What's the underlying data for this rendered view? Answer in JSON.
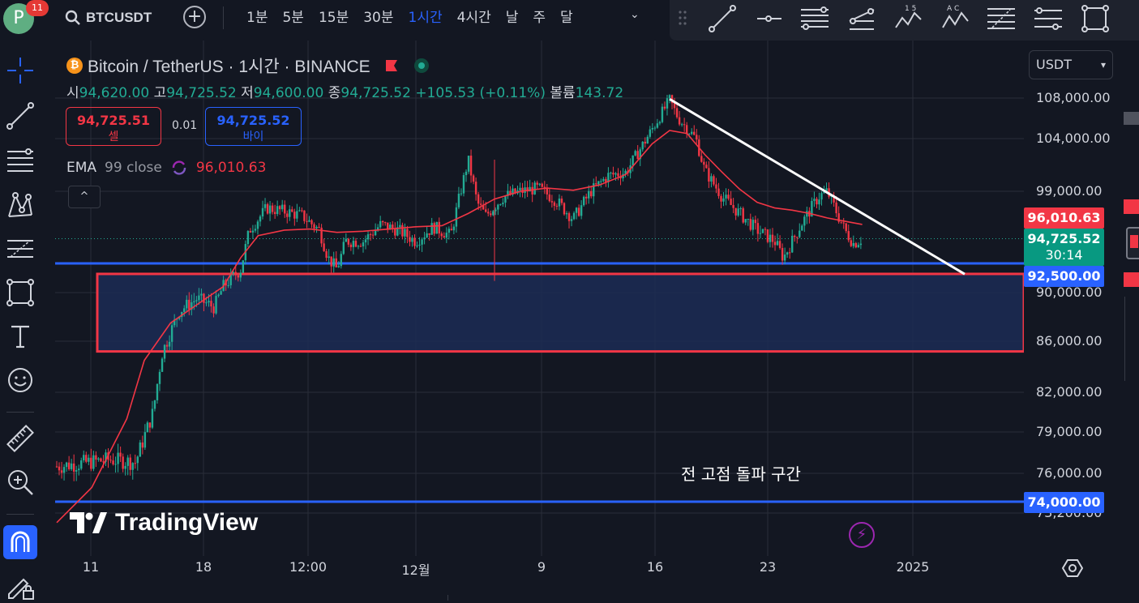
{
  "header": {
    "avatar_letter": "P",
    "notification_count": "11",
    "symbol": "BTCUSDT",
    "add_symbol": "+",
    "intervals": [
      "1분",
      "5분",
      "15분",
      "30분",
      "1시간",
      "4시간",
      "날",
      "주",
      "달"
    ],
    "active_interval": "1시간",
    "interval_chevron": "⌄"
  },
  "drawing_tools": [
    "trend-line-icon",
    "horizontal-ray-icon",
    "parallel-channel-icon",
    "pitchfork-icon",
    "elliott-wave-icon",
    "xabcd-pattern-icon",
    "fib-retracement-icon",
    "prediction-icon",
    "rectangle-icon"
  ],
  "drawing_tool_labels": {
    "elliott": "1 5",
    "pattern": "A C"
  },
  "left_tools": [
    "crosshair-icon",
    "trend-line-icon",
    "fib-icon",
    "pattern-icon",
    "prediction-icon",
    "rectangle-icon",
    "text-icon",
    "emoji-icon",
    "ruler-icon",
    "zoom-in-icon",
    "magnet-icon",
    "pencil-lock-icon"
  ],
  "legend": {
    "coin_glyph": "₿",
    "title": "Bitcoin / TetherUS · 1시간 · BINANCE",
    "ohlc": {
      "open_label": "시",
      "open": "94,620.00",
      "high_label": "고",
      "high": "94,725.52",
      "low_label": "저",
      "low": "94,600.00",
      "close_label": "종",
      "close": "94,725.52",
      "change": "+105.53 (+0.11%)",
      "volume_label": "볼륨",
      "volume": "143.72"
    },
    "sell": {
      "price": "94,725.51",
      "label": "셀"
    },
    "spread": "0.01",
    "buy": {
      "price": "94,725.52",
      "label": "바이"
    },
    "ema": {
      "name": "EMA",
      "params": "99 close",
      "value": "96,010.63"
    },
    "collapse": "^"
  },
  "annotation_text": "전 고점 돌파 구간",
  "watermark": "TradingView",
  "price_scale": {
    "currency": "USDT",
    "ticks": [
      "108,000.00",
      "104,000.00",
      "99,000.00",
      "90,000.00",
      "86,000.00",
      "82,000.00",
      "79,000.00",
      "76,000.00",
      "73,200.00"
    ],
    "labels": {
      "ema": "96,010.63",
      "last": "94,725.52",
      "countdown": "30:14",
      "support": "92,500.00",
      "lower_support": "74,000.00"
    }
  },
  "time_scale": {
    "ticks": [
      "11",
      "18",
      "12:00",
      "12월",
      "9",
      "16",
      "23",
      "2025"
    ]
  },
  "colors": {
    "background": "#131722",
    "up": "#22ab94",
    "down": "#f23645",
    "ema": "#f23645",
    "horizontal_lines": "#2962ff",
    "zone_border": "#f23645",
    "zone_fill": "#1c2b55",
    "trendline": "#ffffff",
    "active": "#2962ff"
  },
  "chart_data": {
    "type": "candlestick",
    "symbol": "Bitcoin / TetherUS",
    "exchange": "BINANCE",
    "interval": "1시간",
    "y_range": [
      71000,
      110000
    ],
    "x_ticks": [
      "11",
      "18",
      "12:00",
      "12월",
      "9",
      "16",
      "23",
      "2025"
    ],
    "price_path": [
      [
        0,
        76500
      ],
      [
        6,
        77000
      ],
      [
        9,
        76800
      ],
      [
        11,
        80500
      ],
      [
        12,
        85000
      ],
      [
        14,
        88500
      ],
      [
        16,
        89500
      ],
      [
        18,
        88800
      ],
      [
        19,
        90500
      ],
      [
        21,
        92000
      ],
      [
        22,
        95500
      ],
      [
        24,
        97500
      ],
      [
        26,
        97200
      ],
      [
        28,
        96800
      ],
      [
        30,
        95500
      ],
      [
        31,
        93000
      ],
      [
        32,
        92000
      ],
      [
        33,
        94500
      ],
      [
        35,
        94500
      ],
      [
        37,
        96000
      ],
      [
        39,
        95500
      ],
      [
        41,
        94500
      ],
      [
        43,
        95800
      ],
      [
        45,
        95000
      ],
      [
        47,
        102000
      ],
      [
        48,
        98000
      ],
      [
        49,
        96800
      ],
      [
        51,
        98500
      ],
      [
        53,
        99000
      ],
      [
        55,
        99300
      ],
      [
        57,
        98200
      ],
      [
        59,
        96500
      ],
      [
        61,
        99000
      ],
      [
        63,
        100500
      ],
      [
        65,
        100800
      ],
      [
        67,
        103500
      ],
      [
        70,
        107800
      ],
      [
        71,
        106000
      ],
      [
        73,
        104000
      ],
      [
        74,
        101000
      ],
      [
        76,
        98500
      ],
      [
        78,
        97000
      ],
      [
        80,
        95500
      ],
      [
        82,
        94500
      ],
      [
        83,
        93000
      ],
      [
        85,
        96000
      ],
      [
        87,
        98500
      ],
      [
        88,
        99000
      ],
      [
        90,
        95500
      ],
      [
        91,
        94300
      ],
      [
        92,
        94725
      ]
    ],
    "ema": {
      "name": "EMA 99 close",
      "value": 96010.63,
      "path": [
        [
          0,
          71500
        ],
        [
          4,
          75000
        ],
        [
          8,
          80000
        ],
        [
          10,
          84500
        ],
        [
          13,
          87500
        ],
        [
          16,
          89000
        ],
        [
          19,
          90500
        ],
        [
          21,
          93000
        ],
        [
          23,
          95000
        ],
        [
          26,
          95500
        ],
        [
          29,
          95600
        ],
        [
          32,
          95300
        ],
        [
          35,
          95400
        ],
        [
          38,
          95600
        ],
        [
          41,
          95800
        ],
        [
          44,
          95900
        ],
        [
          47,
          97000
        ],
        [
          50,
          98300
        ],
        [
          53,
          99000
        ],
        [
          56,
          99300
        ],
        [
          59,
          99100
        ],
        [
          62,
          99600
        ],
        [
          65,
          100600
        ],
        [
          68,
          103500
        ],
        [
          70,
          104800
        ],
        [
          72,
          104500
        ],
        [
          74,
          102500
        ],
        [
          76,
          100800
        ],
        [
          78,
          99200
        ],
        [
          80,
          98000
        ],
        [
          82,
          97500
        ],
        [
          84,
          97300
        ],
        [
          86,
          97000
        ],
        [
          88,
          96600
        ],
        [
          90,
          96300
        ],
        [
          92,
          96010
        ]
      ]
    },
    "last_price": 94725.52,
    "horizontal_lines": [
      92500,
      74000
    ],
    "zone": {
      "from_price": 85200,
      "to_price": 91600
    },
    "trendline": {
      "from": [
        70,
        107900
      ],
      "to": [
        100,
        92000
      ]
    }
  }
}
